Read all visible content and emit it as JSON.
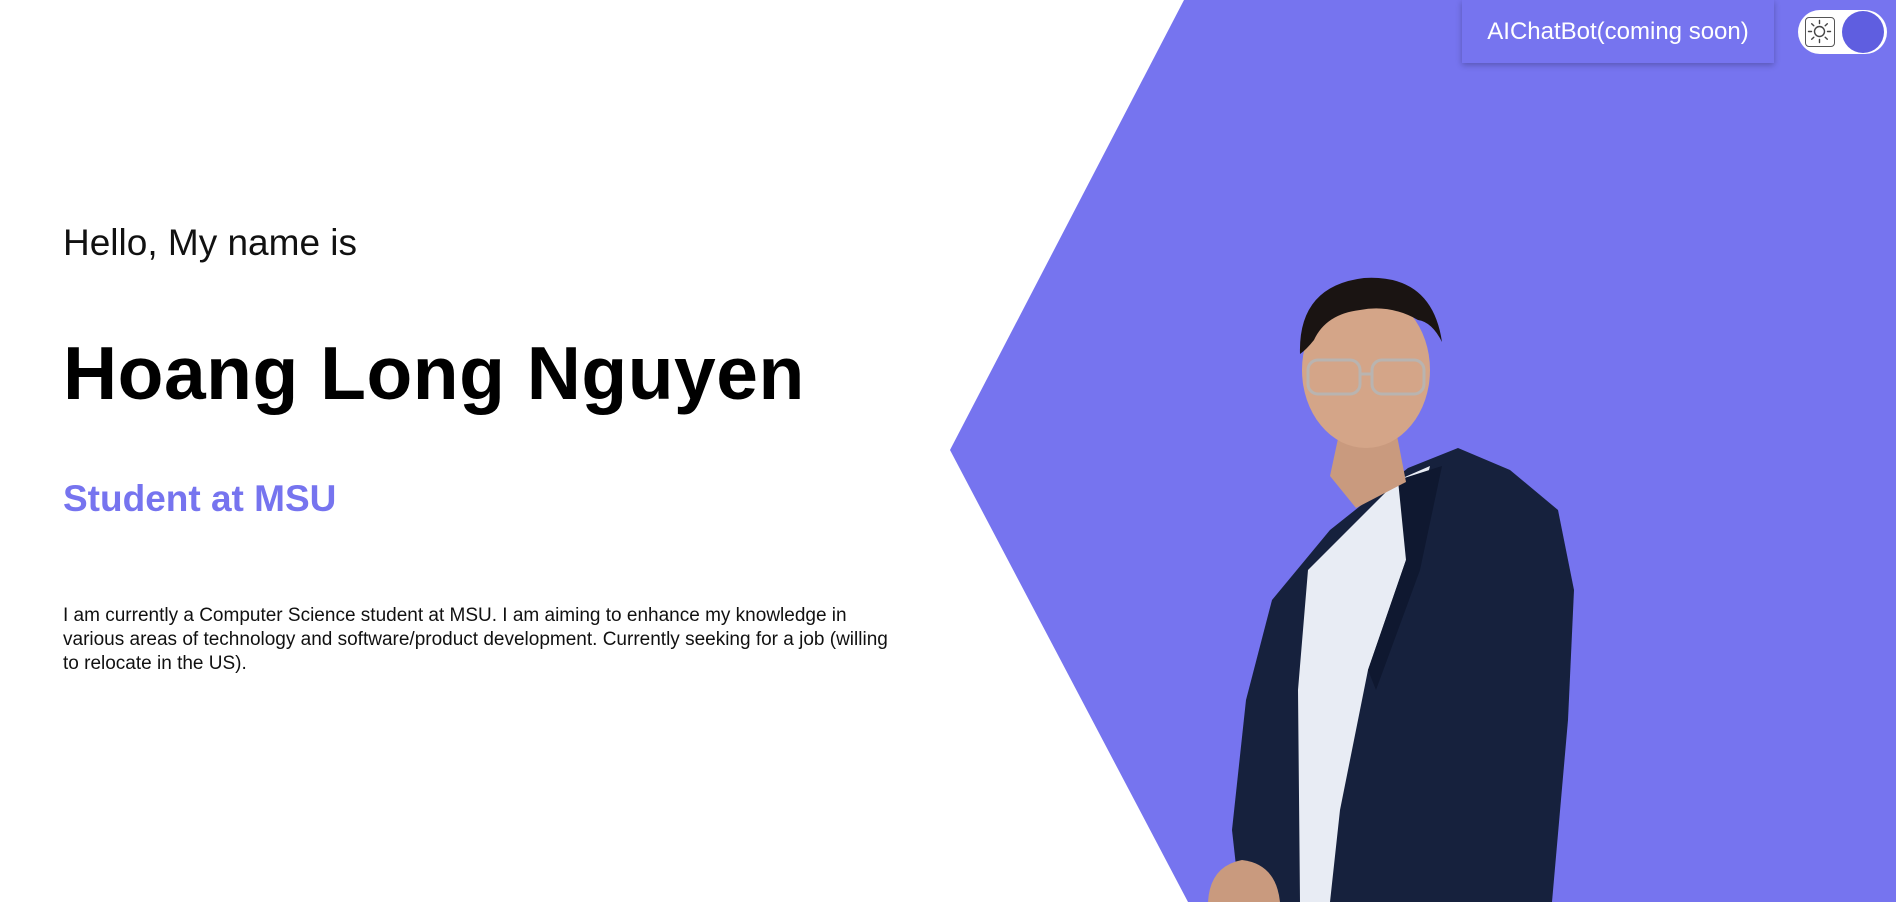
{
  "colors": {
    "accent": "#7674ef",
    "toggle_knob": "#5f5ee0",
    "background": "#ffffff"
  },
  "header": {
    "chatbot_button_label": "AIChatBot(coming soon)",
    "theme_toggle_icon": "sun-icon"
  },
  "hero": {
    "greeting": "Hello, My name is",
    "name": "Hoang Long Nguyen",
    "role": "Student at MSU",
    "bio": "I am currently a Computer Science student at MSU. I am aiming to enhance my knowledge in various areas of technology and software/product development. Currently seeking for a job (willing to relocate in the US)."
  }
}
